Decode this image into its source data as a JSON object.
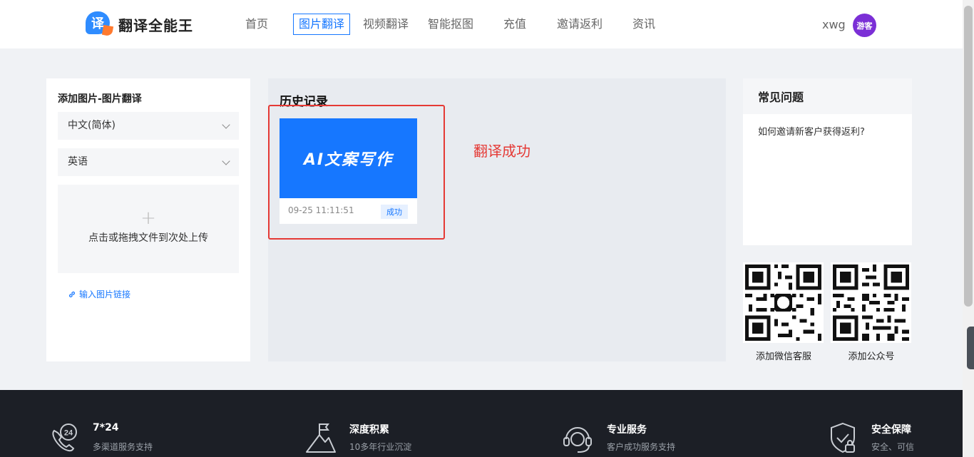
{
  "header": {
    "logo_glyph": "译",
    "logo_text": "翻译全能王",
    "nav": [
      "首页",
      "图片翻译",
      "视频翻译",
      "智能抠图",
      "充值",
      "邀请返利",
      "资讯"
    ],
    "active_nav": "图片翻译",
    "username": "xwg",
    "avatar_label": "游客"
  },
  "left": {
    "title": "添加图片-图片翻译",
    "source_lang": "中文(简体)",
    "target_lang": "英语",
    "upload_plus": "+",
    "upload_text": "点击或拖拽文件到次处上传",
    "link_text": "输入图片链接"
  },
  "history": {
    "title": "历史记录",
    "items": [
      {
        "thumb_text": "AI文案写作",
        "date": "09-25 11:11:51",
        "status": "成功"
      }
    ],
    "annotation": "翻译成功"
  },
  "faq": {
    "title": "常见问题",
    "items": [
      "如何邀请新客户获得返利?"
    ]
  },
  "qr": {
    "wechat_label": "添加微信客服",
    "official_label": "添加公众号"
  },
  "footer": {
    "features": [
      {
        "icon": "phone-24-icon",
        "title": "7*24",
        "subtitle": "多渠道服务支持"
      },
      {
        "icon": "flag-mountain-icon",
        "title": "深度积累",
        "subtitle": "10多年行业沉淀"
      },
      {
        "icon": "headset-icon",
        "title": "专业服务",
        "subtitle": "客户成功服务支持"
      },
      {
        "icon": "shield-lock-icon",
        "title": "安全保障",
        "subtitle": "安全、可信"
      }
    ]
  },
  "colors": {
    "accent": "#1677ff",
    "annotation": "#e53935",
    "footer_bg": "#1c1f26"
  }
}
